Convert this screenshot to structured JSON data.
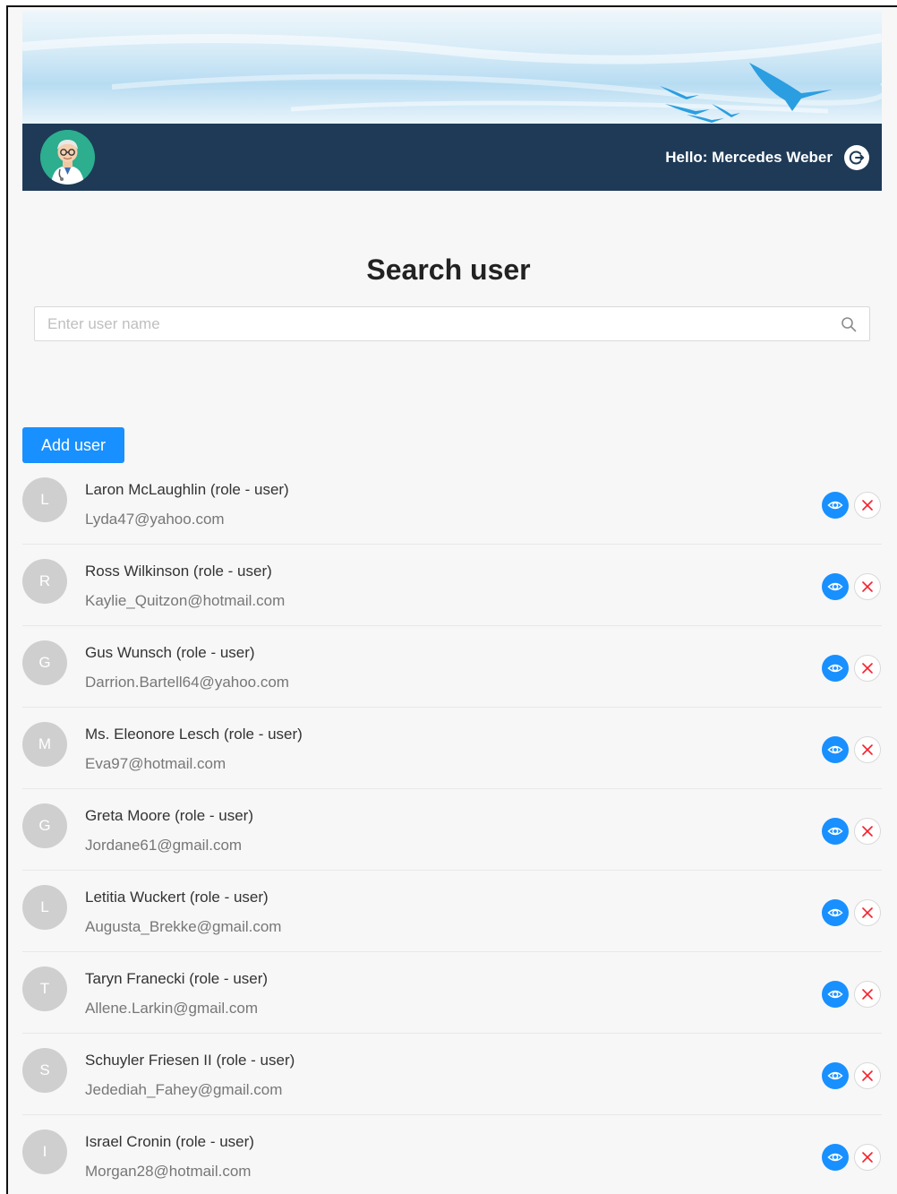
{
  "header": {
    "greeting": "Hello: Mercedes Weber",
    "colors": {
      "bar": "#1e3a57",
      "accent": "#1890ff",
      "danger": "#f5222d"
    },
    "icons": {
      "avatar": "doctor-avatar-icon",
      "logout": "logout-icon"
    }
  },
  "search": {
    "title": "Search user",
    "placeholder": "Enter user name",
    "value": ""
  },
  "actions": {
    "add_label": "Add user"
  },
  "users": [
    {
      "initial": "L",
      "name": "Laron McLaughlin (role - user)",
      "email": "Lyda47@yahoo.com"
    },
    {
      "initial": "R",
      "name": "Ross Wilkinson (role - user)",
      "email": "Kaylie_Quitzon@hotmail.com"
    },
    {
      "initial": "G",
      "name": "Gus Wunsch (role - user)",
      "email": "Darrion.Bartell64@yahoo.com"
    },
    {
      "initial": "M",
      "name": "Ms. Eleonore Lesch (role - user)",
      "email": "Eva97@hotmail.com"
    },
    {
      "initial": "G",
      "name": "Greta Moore (role - user)",
      "email": "Jordane61@gmail.com"
    },
    {
      "initial": "L",
      "name": "Letitia Wuckert (role - user)",
      "email": "Augusta_Brekke@gmail.com"
    },
    {
      "initial": "T",
      "name": "Taryn Franecki (role - user)",
      "email": "Allene.Larkin@gmail.com"
    },
    {
      "initial": "S",
      "name": "Schuyler Friesen II (role - user)",
      "email": "Jedediah_Fahey@gmail.com"
    },
    {
      "initial": "I",
      "name": "Israel Cronin (role - user)",
      "email": "Morgan28@hotmail.com"
    }
  ]
}
